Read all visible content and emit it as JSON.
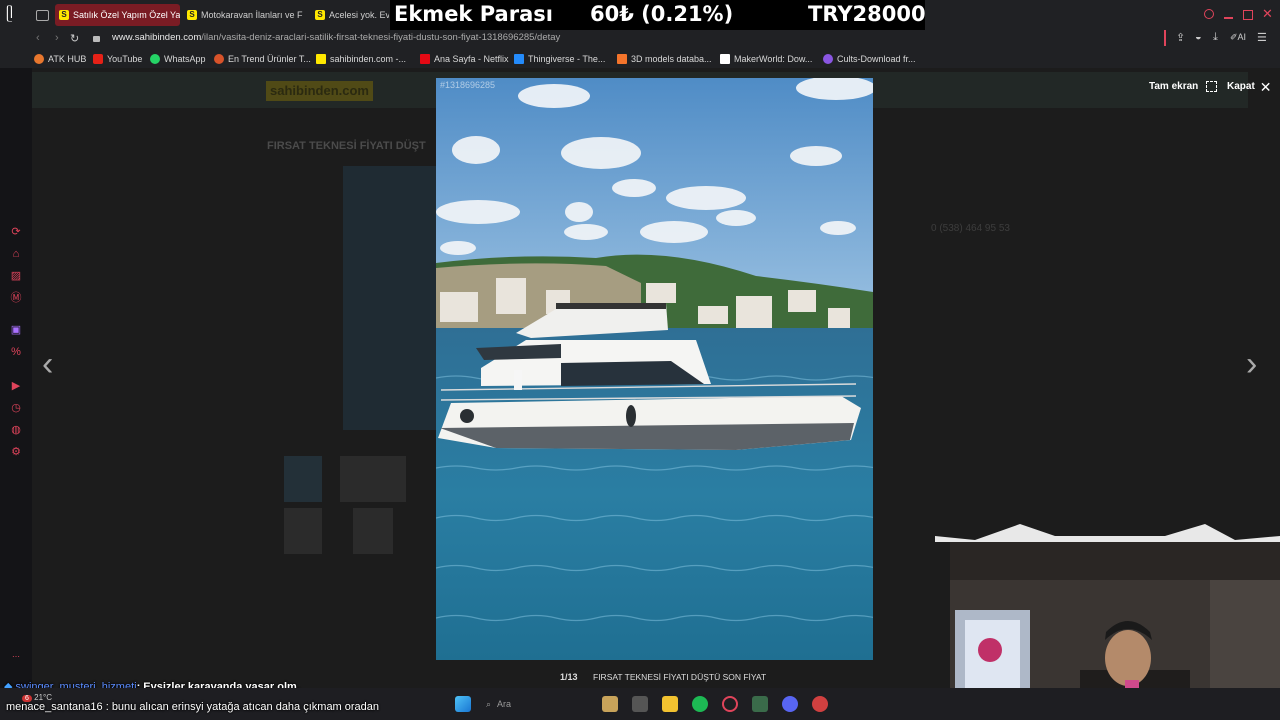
{
  "tabs": [
    {
      "label": "Satılık Özel Yapım Özel Yap",
      "active": true
    },
    {
      "label": "Motokaravan İlanları ve Fiy",
      "active": false
    },
    {
      "label": "Acelesi yok. Ev",
      "active": false
    }
  ],
  "ticker": {
    "label": "Ekmek Parası",
    "amount": "60₺ (0.21%)",
    "goal": "TRY28000"
  },
  "address": {
    "domain": "www.sahibinden.com",
    "path": "/ilan/vasita-deniz-araclari-satilik-firsat-teknesi-fiyati-dustu-son-fiyat-1318696285/detay"
  },
  "bookmarks": [
    {
      "label": "ATK HUB",
      "icon": "atk-icon",
      "color": "#e8772e"
    },
    {
      "label": "YouTube",
      "icon": "youtube-icon",
      "color": "#e62117"
    },
    {
      "label": "WhatsApp",
      "icon": "whatsapp-icon",
      "color": "#25d366"
    },
    {
      "label": "En Trend Ürünler T...",
      "icon": "trend-icon",
      "color": "#d8532a"
    },
    {
      "label": "sahibinden.com -...",
      "icon": "sahibinden-icon",
      "color": "#ffe800"
    },
    {
      "label": "Ana Sayfa - Netflix",
      "icon": "netflix-icon",
      "color": "#e50914"
    },
    {
      "label": "Thingiverse - The...",
      "icon": "thingiverse-icon",
      "color": "#248bfb"
    },
    {
      "label": "3D models databa...",
      "icon": "models-icon",
      "color": "#f4742b"
    },
    {
      "label": "MakerWorld: Dow...",
      "icon": "makerworld-icon",
      "color": "#ffffff"
    },
    {
      "label": "Cults-Download fr...",
      "icon": "cults-icon",
      "color": "#8a56e2"
    }
  ],
  "listing": {
    "site_logo": "sahibinden.com",
    "title": "FIRSAT TEKNESİ FİYATI DÜŞT",
    "id_badge": "#1318696285",
    "phone": "0 (538) 464 95 53"
  },
  "lightbox": {
    "fullscreen_label": "Tam ekran",
    "close_label": "Kapat",
    "counter": "1/13",
    "caption": "FIRSAT TEKNESİ FİYATI DÜŞTÜ SON FİYAT"
  },
  "chat": [
    {
      "user": "swinger_musteri_hizmeti",
      "message": ": Evsizler karavanda yaşar olm."
    },
    {
      "user": "menace_santana16",
      "message": ": bunu alıcan erinsyi yatağa atıcan daha çıkmam oradan"
    }
  ],
  "taskbar": {
    "search_placeholder": "Ara",
    "weather": "21°C",
    "notification_count": "6"
  },
  "colors": {
    "accent": "#e0445b",
    "overlay": "#000000",
    "link": "#5b8cff"
  }
}
